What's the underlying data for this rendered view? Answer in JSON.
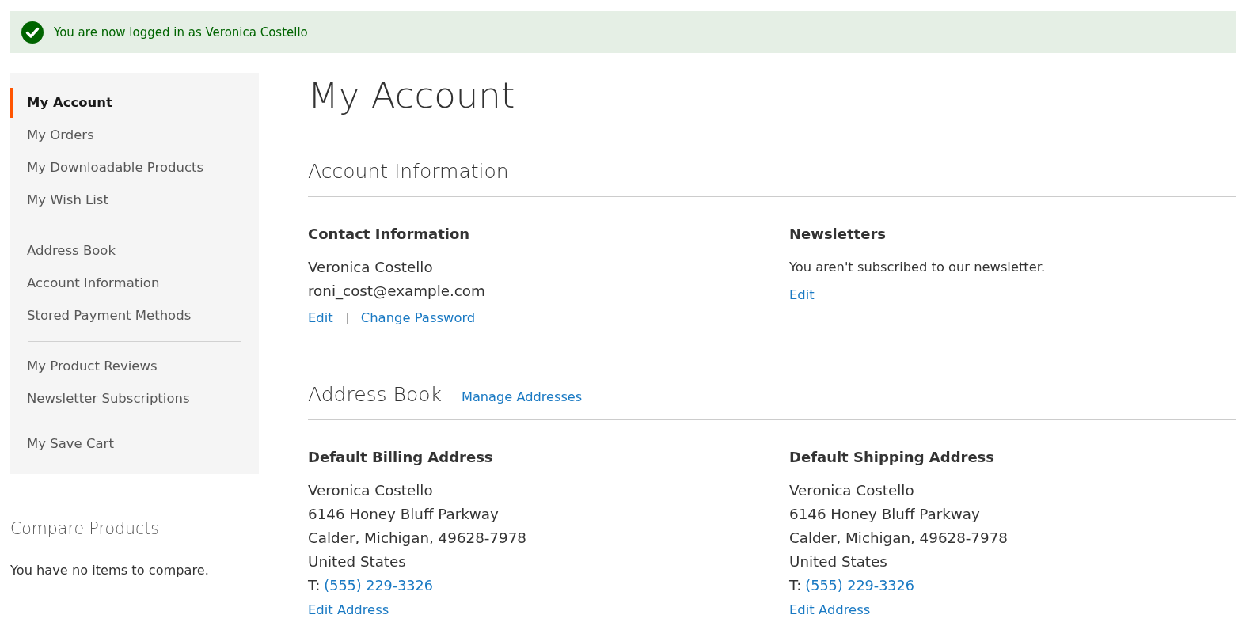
{
  "message": {
    "kind": "success",
    "text": "You are now logged in as Veronica Costello"
  },
  "sidebar": {
    "groups": [
      {
        "divider_above": false,
        "items": [
          {
            "label": "My Account",
            "selected": true
          },
          {
            "label": "My Orders",
            "selected": false
          },
          {
            "label": "My Downloadable Products",
            "selected": false
          },
          {
            "label": "My Wish List",
            "selected": false
          }
        ]
      },
      {
        "divider_above": true,
        "items": [
          {
            "label": "Address Book",
            "selected": false
          },
          {
            "label": "Account Information",
            "selected": false
          },
          {
            "label": "Stored Payment Methods",
            "selected": false
          }
        ]
      },
      {
        "divider_above": true,
        "items": [
          {
            "label": "My Product Reviews",
            "selected": false
          },
          {
            "label": "Newsletter Subscriptions",
            "selected": false
          }
        ]
      },
      {
        "divider_above": false,
        "items": [
          {
            "label": "My Save Cart",
            "selected": false
          }
        ]
      }
    ]
  },
  "compare": {
    "title": "Compare Products",
    "text": "You have no items to compare."
  },
  "page_title": "My Account",
  "account_information": {
    "title": "Account Information",
    "contact": {
      "title": "Contact Information",
      "name": "Veronica Costello",
      "email": "roni_cost@example.com",
      "links": [
        "Edit",
        "Change Password"
      ]
    },
    "newsletters": {
      "title": "Newsletters",
      "text": "You aren't subscribed to our newsletter.",
      "links": [
        "Edit"
      ]
    }
  },
  "address_book": {
    "title": "Address Book",
    "manage_link": "Manage Addresses",
    "addresses": [
      {
        "title": "Default Billing Address",
        "lines": [
          "Veronica Costello",
          "6146 Honey Bluff Parkway",
          "Calder, Michigan, 49628-7978",
          "United States"
        ],
        "phone_label": "T:",
        "phone": "(555) 229-3326",
        "edit_link": "Edit Address"
      },
      {
        "title": "Default Shipping Address",
        "lines": [
          "Veronica Costello",
          "6146 Honey Bluff Parkway",
          "Calder, Michigan, 49628-7978",
          "United States"
        ],
        "phone_label": "T:",
        "phone": "(555) 229-3326",
        "edit_link": "Edit Address"
      }
    ]
  }
}
